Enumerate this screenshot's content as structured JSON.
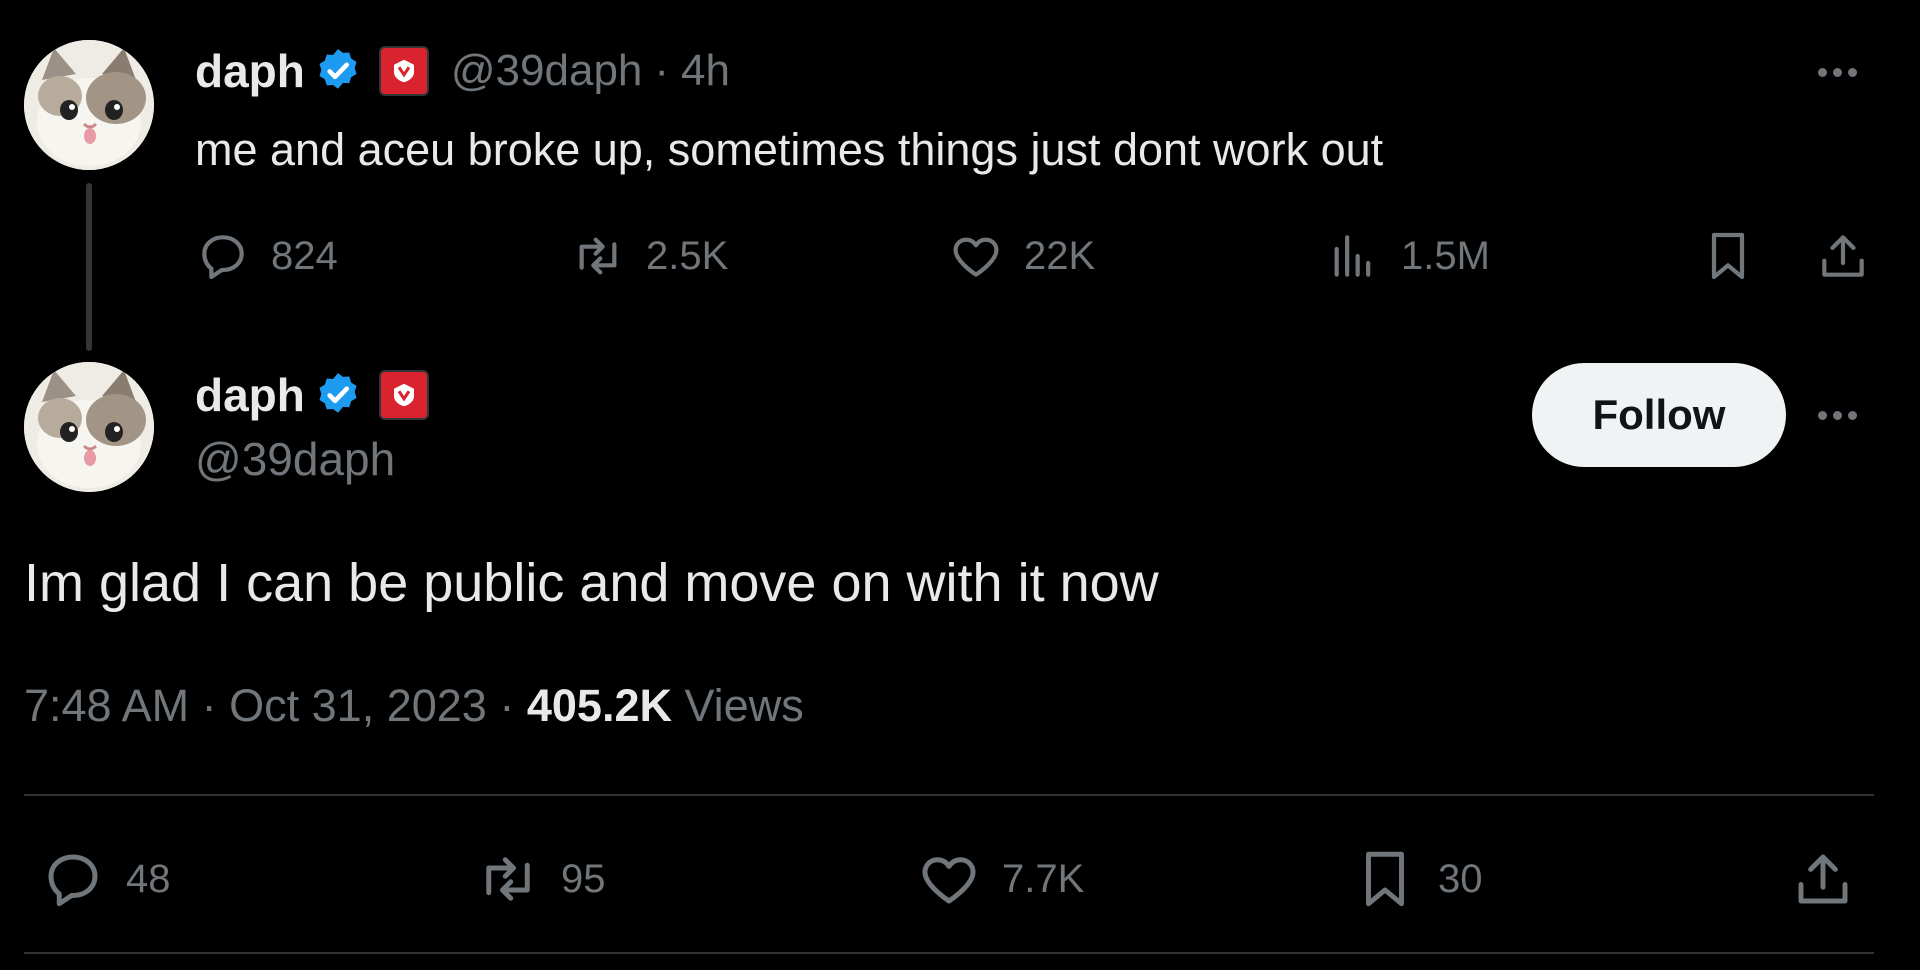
{
  "parent_tweet": {
    "author_name": "daph",
    "handle": "@39daph",
    "separator": "·",
    "time_ago": "4h",
    "text": "me and aceu broke up, sometimes things just dont work out",
    "replies": "824",
    "retweets": "2.5K",
    "likes": "22K",
    "views": "1.5M"
  },
  "main_tweet": {
    "author_name": "daph",
    "handle": "@39daph",
    "follow_label": "Follow",
    "text": "Im glad I can be public and move on with it now",
    "time": "7:48 AM",
    "date": "Oct 31, 2023",
    "separator": "·",
    "views_count": "405.2K",
    "views_label": "Views",
    "replies": "48",
    "retweets": "95",
    "likes": "7.7K",
    "bookmarks": "30"
  },
  "icons": {
    "verified": "verified-badge-icon",
    "affiliate": "affiliate-badge-icon",
    "reply": "reply-icon",
    "retweet": "retweet-icon",
    "like": "heart-icon",
    "views": "views-icon",
    "bookmark": "bookmark-icon",
    "share": "share-icon",
    "more": "more-icon"
  },
  "colors": {
    "background": "#000000",
    "text": "#e7e9ea",
    "muted": "#71767b",
    "verified_blue": "#1d9bf0",
    "affiliate_red": "#d9232e",
    "follow_button_bg": "#eff3f4"
  }
}
